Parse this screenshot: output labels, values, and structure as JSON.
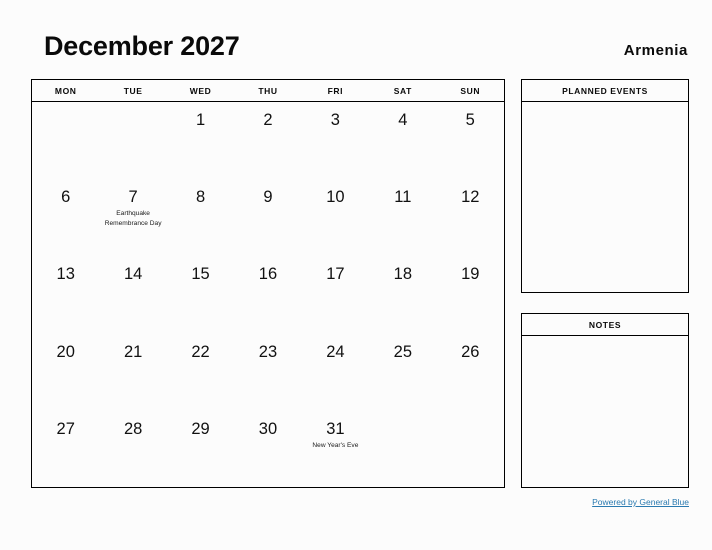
{
  "header": {
    "title": "December 2027",
    "country": "Armenia"
  },
  "calendar": {
    "weekdays": [
      "MON",
      "TUE",
      "WED",
      "THU",
      "FRI",
      "SAT",
      "SUN"
    ],
    "weeks": [
      [
        {
          "day": "",
          "event": ""
        },
        {
          "day": "",
          "event": ""
        },
        {
          "day": "1",
          "event": ""
        },
        {
          "day": "2",
          "event": ""
        },
        {
          "day": "3",
          "event": ""
        },
        {
          "day": "4",
          "event": ""
        },
        {
          "day": "5",
          "event": ""
        }
      ],
      [
        {
          "day": "6",
          "event": ""
        },
        {
          "day": "7",
          "event": "Earthquake Remembrance Day"
        },
        {
          "day": "8",
          "event": ""
        },
        {
          "day": "9",
          "event": ""
        },
        {
          "day": "10",
          "event": ""
        },
        {
          "day": "11",
          "event": ""
        },
        {
          "day": "12",
          "event": ""
        }
      ],
      [
        {
          "day": "13",
          "event": ""
        },
        {
          "day": "14",
          "event": ""
        },
        {
          "day": "15",
          "event": ""
        },
        {
          "day": "16",
          "event": ""
        },
        {
          "day": "17",
          "event": ""
        },
        {
          "day": "18",
          "event": ""
        },
        {
          "day": "19",
          "event": ""
        }
      ],
      [
        {
          "day": "20",
          "event": ""
        },
        {
          "day": "21",
          "event": ""
        },
        {
          "day": "22",
          "event": ""
        },
        {
          "day": "23",
          "event": ""
        },
        {
          "day": "24",
          "event": ""
        },
        {
          "day": "25",
          "event": ""
        },
        {
          "day": "26",
          "event": ""
        }
      ],
      [
        {
          "day": "27",
          "event": ""
        },
        {
          "day": "28",
          "event": ""
        },
        {
          "day": "29",
          "event": ""
        },
        {
          "day": "30",
          "event": ""
        },
        {
          "day": "31",
          "event": "New Year's Eve"
        },
        {
          "day": "",
          "event": ""
        },
        {
          "day": "",
          "event": ""
        }
      ]
    ]
  },
  "panels": {
    "planned_events": {
      "title": "PLANNED EVENTS",
      "content": ""
    },
    "notes": {
      "title": "NOTES",
      "content": ""
    }
  },
  "footer": {
    "link_text": "Powered by General Blue"
  },
  "colors": {
    "page_background": "#fcfcfc",
    "border": "#000000",
    "text": "#111111",
    "link": "#2a7ab0"
  }
}
